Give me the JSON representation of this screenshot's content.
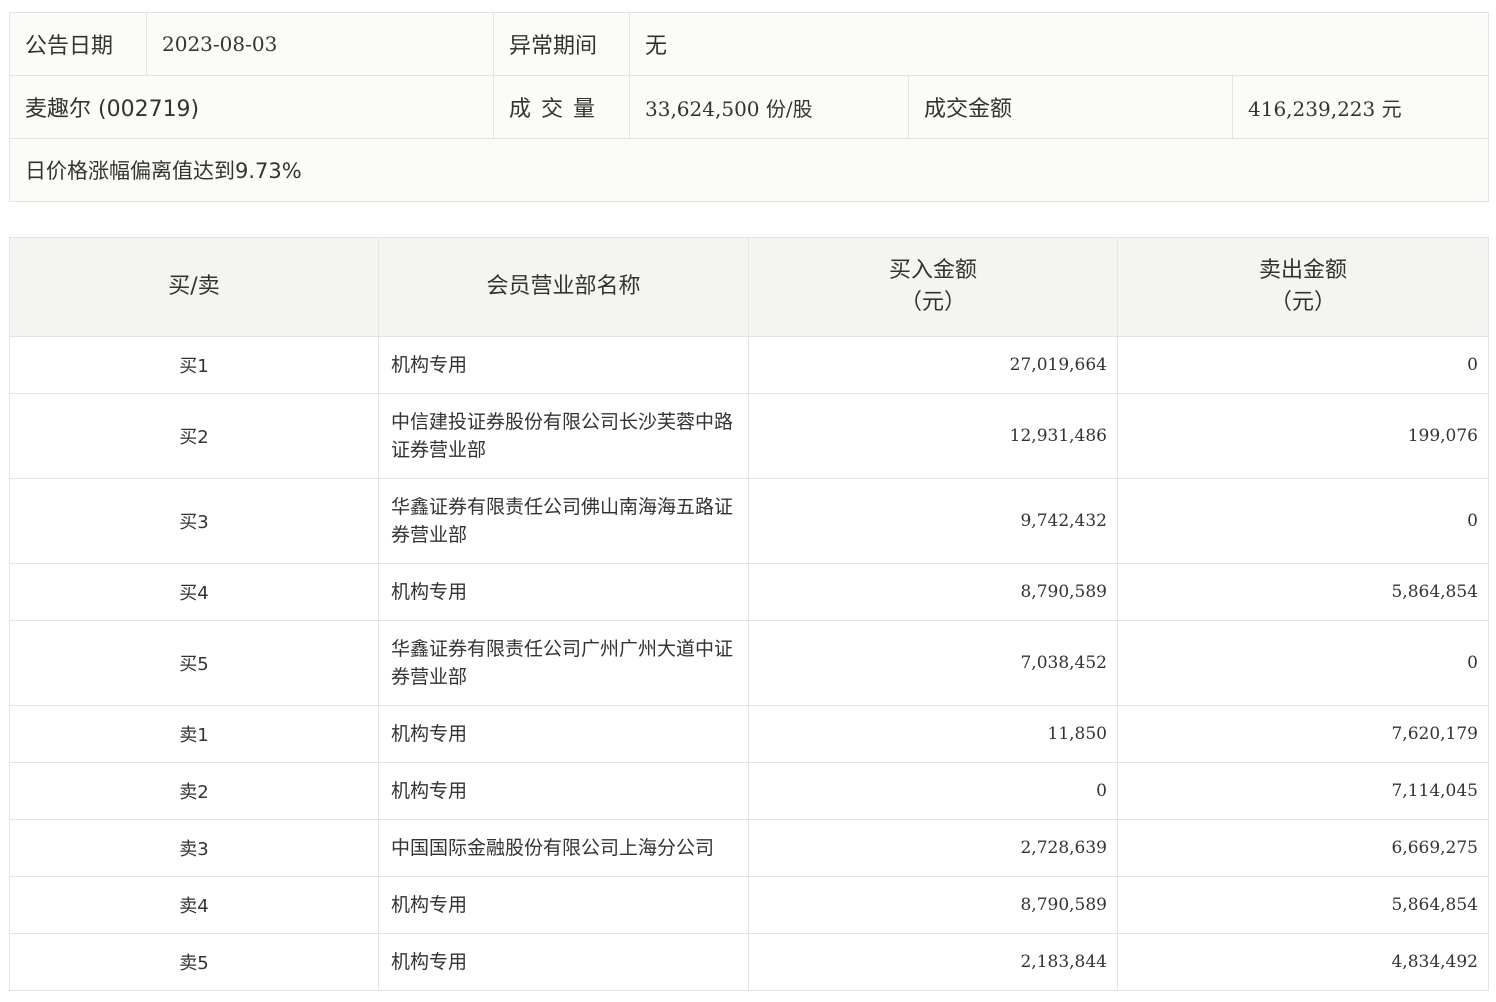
{
  "summary": {
    "announce_date_label": "公告日期",
    "announce_date": "2023-08-03",
    "abnormal_period_label": "异常期间",
    "abnormal_period": "无",
    "stock_name": "麦趣尔 (002719)",
    "volume_label": "成交量",
    "volume": "33,624,500 份/股",
    "turnover_label": "成交金额",
    "turnover": "416,239,223 元",
    "reason": "日价格涨幅偏离值达到9.73%"
  },
  "table": {
    "headers": {
      "side": "买/卖",
      "department": "会员营业部名称",
      "buy_amount": "买入金额",
      "buy_unit": "（元）",
      "sell_amount": "卖出金额",
      "sell_unit": "（元）"
    },
    "rows": [
      {
        "side": "买1",
        "department": "机构专用",
        "buy": "27,019,664",
        "sell": "0"
      },
      {
        "side": "买2",
        "department": "中信建投证券股份有限公司长沙芙蓉中路证券营业部",
        "buy": "12,931,486",
        "sell": "199,076"
      },
      {
        "side": "买3",
        "department": "华鑫证券有限责任公司佛山南海海五路证券营业部",
        "buy": "9,742,432",
        "sell": "0"
      },
      {
        "side": "买4",
        "department": "机构专用",
        "buy": "8,790,589",
        "sell": "5,864,854"
      },
      {
        "side": "买5",
        "department": "华鑫证券有限责任公司广州广州大道中证券营业部",
        "buy": "7,038,452",
        "sell": "0"
      },
      {
        "side": "卖1",
        "department": "机构专用",
        "buy": "11,850",
        "sell": "7,620,179"
      },
      {
        "side": "卖2",
        "department": "机构专用",
        "buy": "0",
        "sell": "7,114,045"
      },
      {
        "side": "卖3",
        "department": "中国国际金融股份有限公司上海分公司",
        "buy": "2,728,639",
        "sell": "6,669,275"
      },
      {
        "side": "卖4",
        "department": "机构专用",
        "buy": "8,790,589",
        "sell": "5,864,854"
      },
      {
        "side": "卖5",
        "department": "机构专用",
        "buy": "2,183,844",
        "sell": "4,834,492"
      }
    ]
  }
}
